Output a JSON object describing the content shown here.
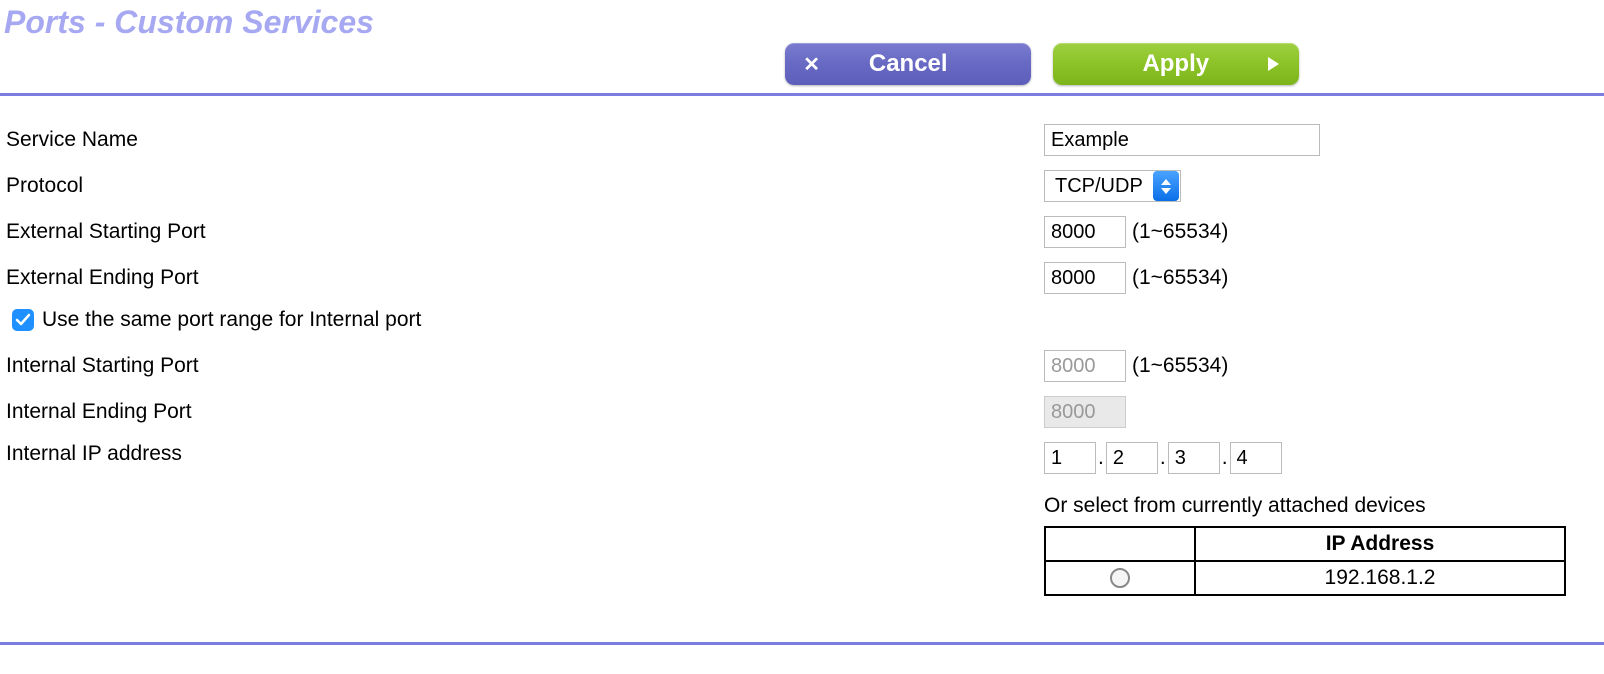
{
  "page_title": "Ports - Custom Services",
  "buttons": {
    "cancel": "Cancel",
    "apply": "Apply"
  },
  "labels": {
    "service_name": "Service Name",
    "protocol": "Protocol",
    "ext_start": "External Starting Port",
    "ext_end": "External Ending Port",
    "same_port": "Use the same port range for Internal port",
    "int_start": "Internal Starting Port",
    "int_end": "Internal Ending Port",
    "int_ip": "Internal IP address",
    "or_select": "Or select from currently attached devices",
    "ip_header": "IP Address"
  },
  "values": {
    "service_name": "Example",
    "protocol": "TCP/UDP",
    "ext_start": "8000",
    "ext_end": "8000",
    "int_start": "8000",
    "int_end": "8000",
    "ip_oct1": "1",
    "ip_oct2": "2",
    "ip_oct3": "3",
    "ip_oct4": "4"
  },
  "hints": {
    "port_range": "(1~65534)"
  },
  "devices": [
    {
      "ip": "192.168.1.2"
    }
  ]
}
